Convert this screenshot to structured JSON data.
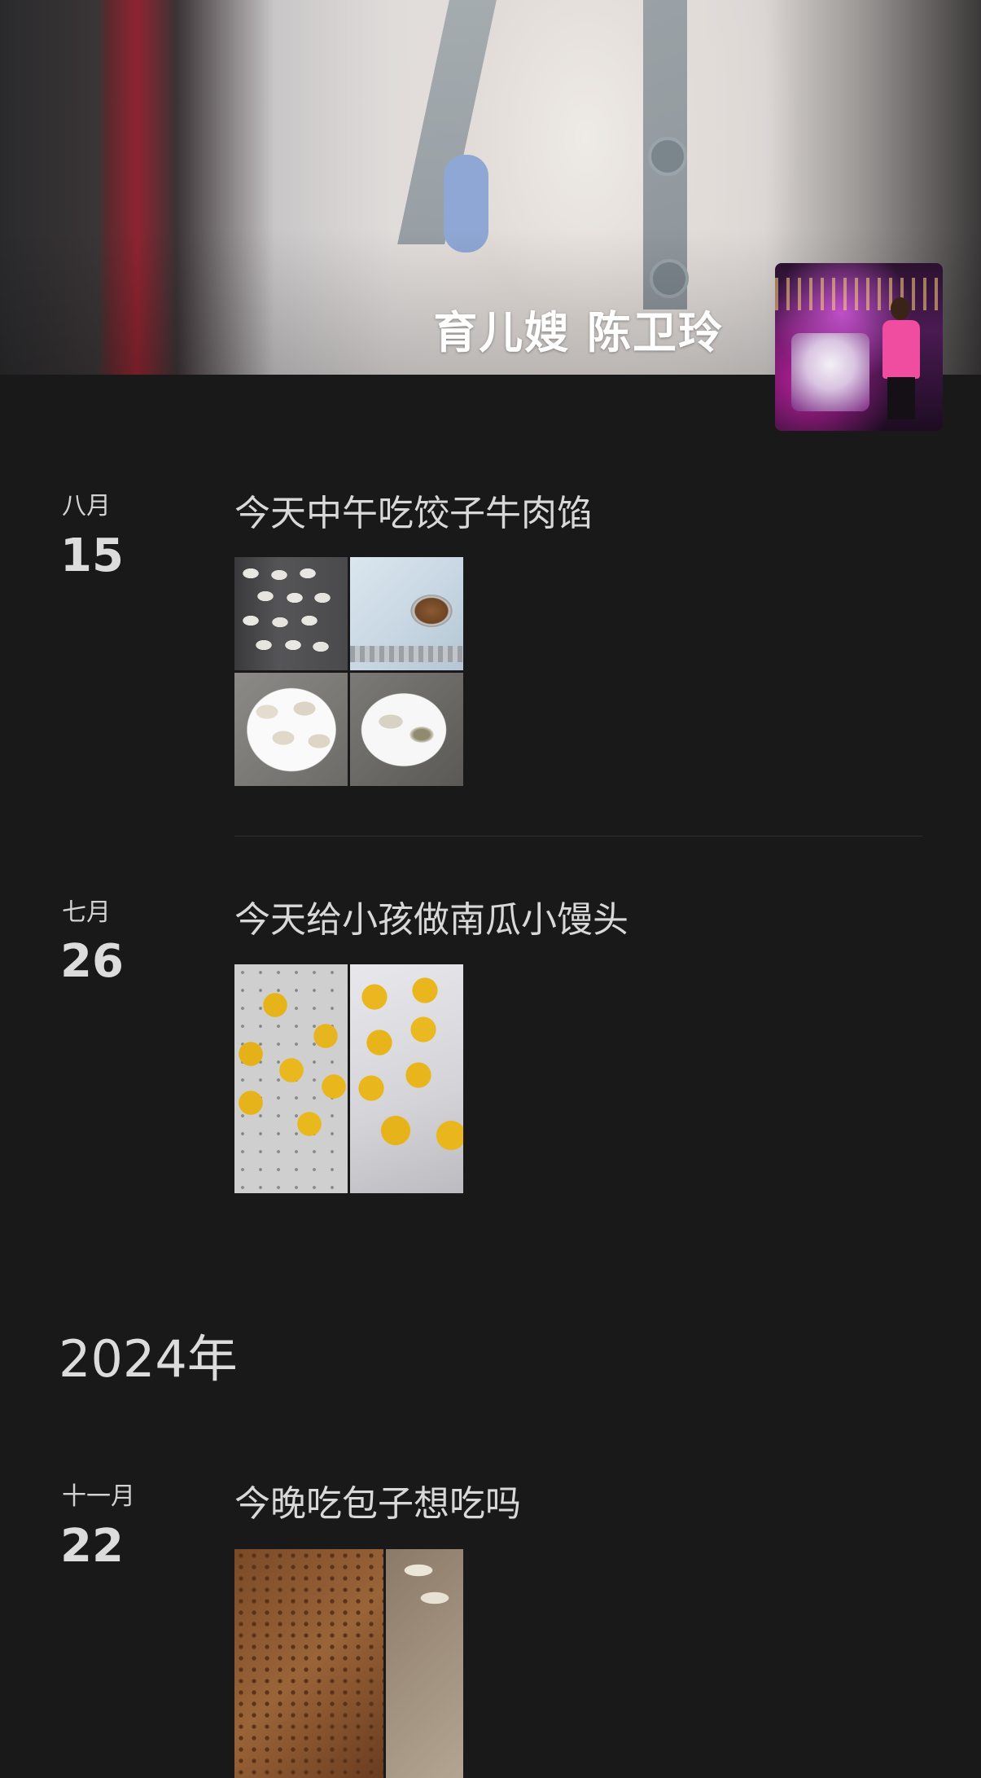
{
  "profile": {
    "name": "育儿嫂 陈卫玲"
  },
  "posts": [
    {
      "month": "八月",
      "day": "15",
      "text": "今天中午吃饺子牛肉馅",
      "images": [
        "dumplings-tray",
        "dumpling-filling-bowl",
        "dumplings-plate",
        "dumplings-plate-bitten"
      ]
    },
    {
      "month": "七月",
      "day": "26",
      "text": "今天给小孩做南瓜小馒头",
      "images": [
        "pumpkin-buns-steamer",
        "pumpkin-buns-plate"
      ]
    }
  ],
  "year_divider": "2024年",
  "posts_2024": [
    {
      "month": "十一月",
      "day": "22",
      "text": "今晚吃包子想吃吗",
      "images": [
        "bun-filling",
        "buns-tray"
      ]
    }
  ],
  "colors": {
    "background": "#191919",
    "text": "#d8d8d8",
    "name": "#ffffff",
    "divider": "#2f2f2f"
  }
}
